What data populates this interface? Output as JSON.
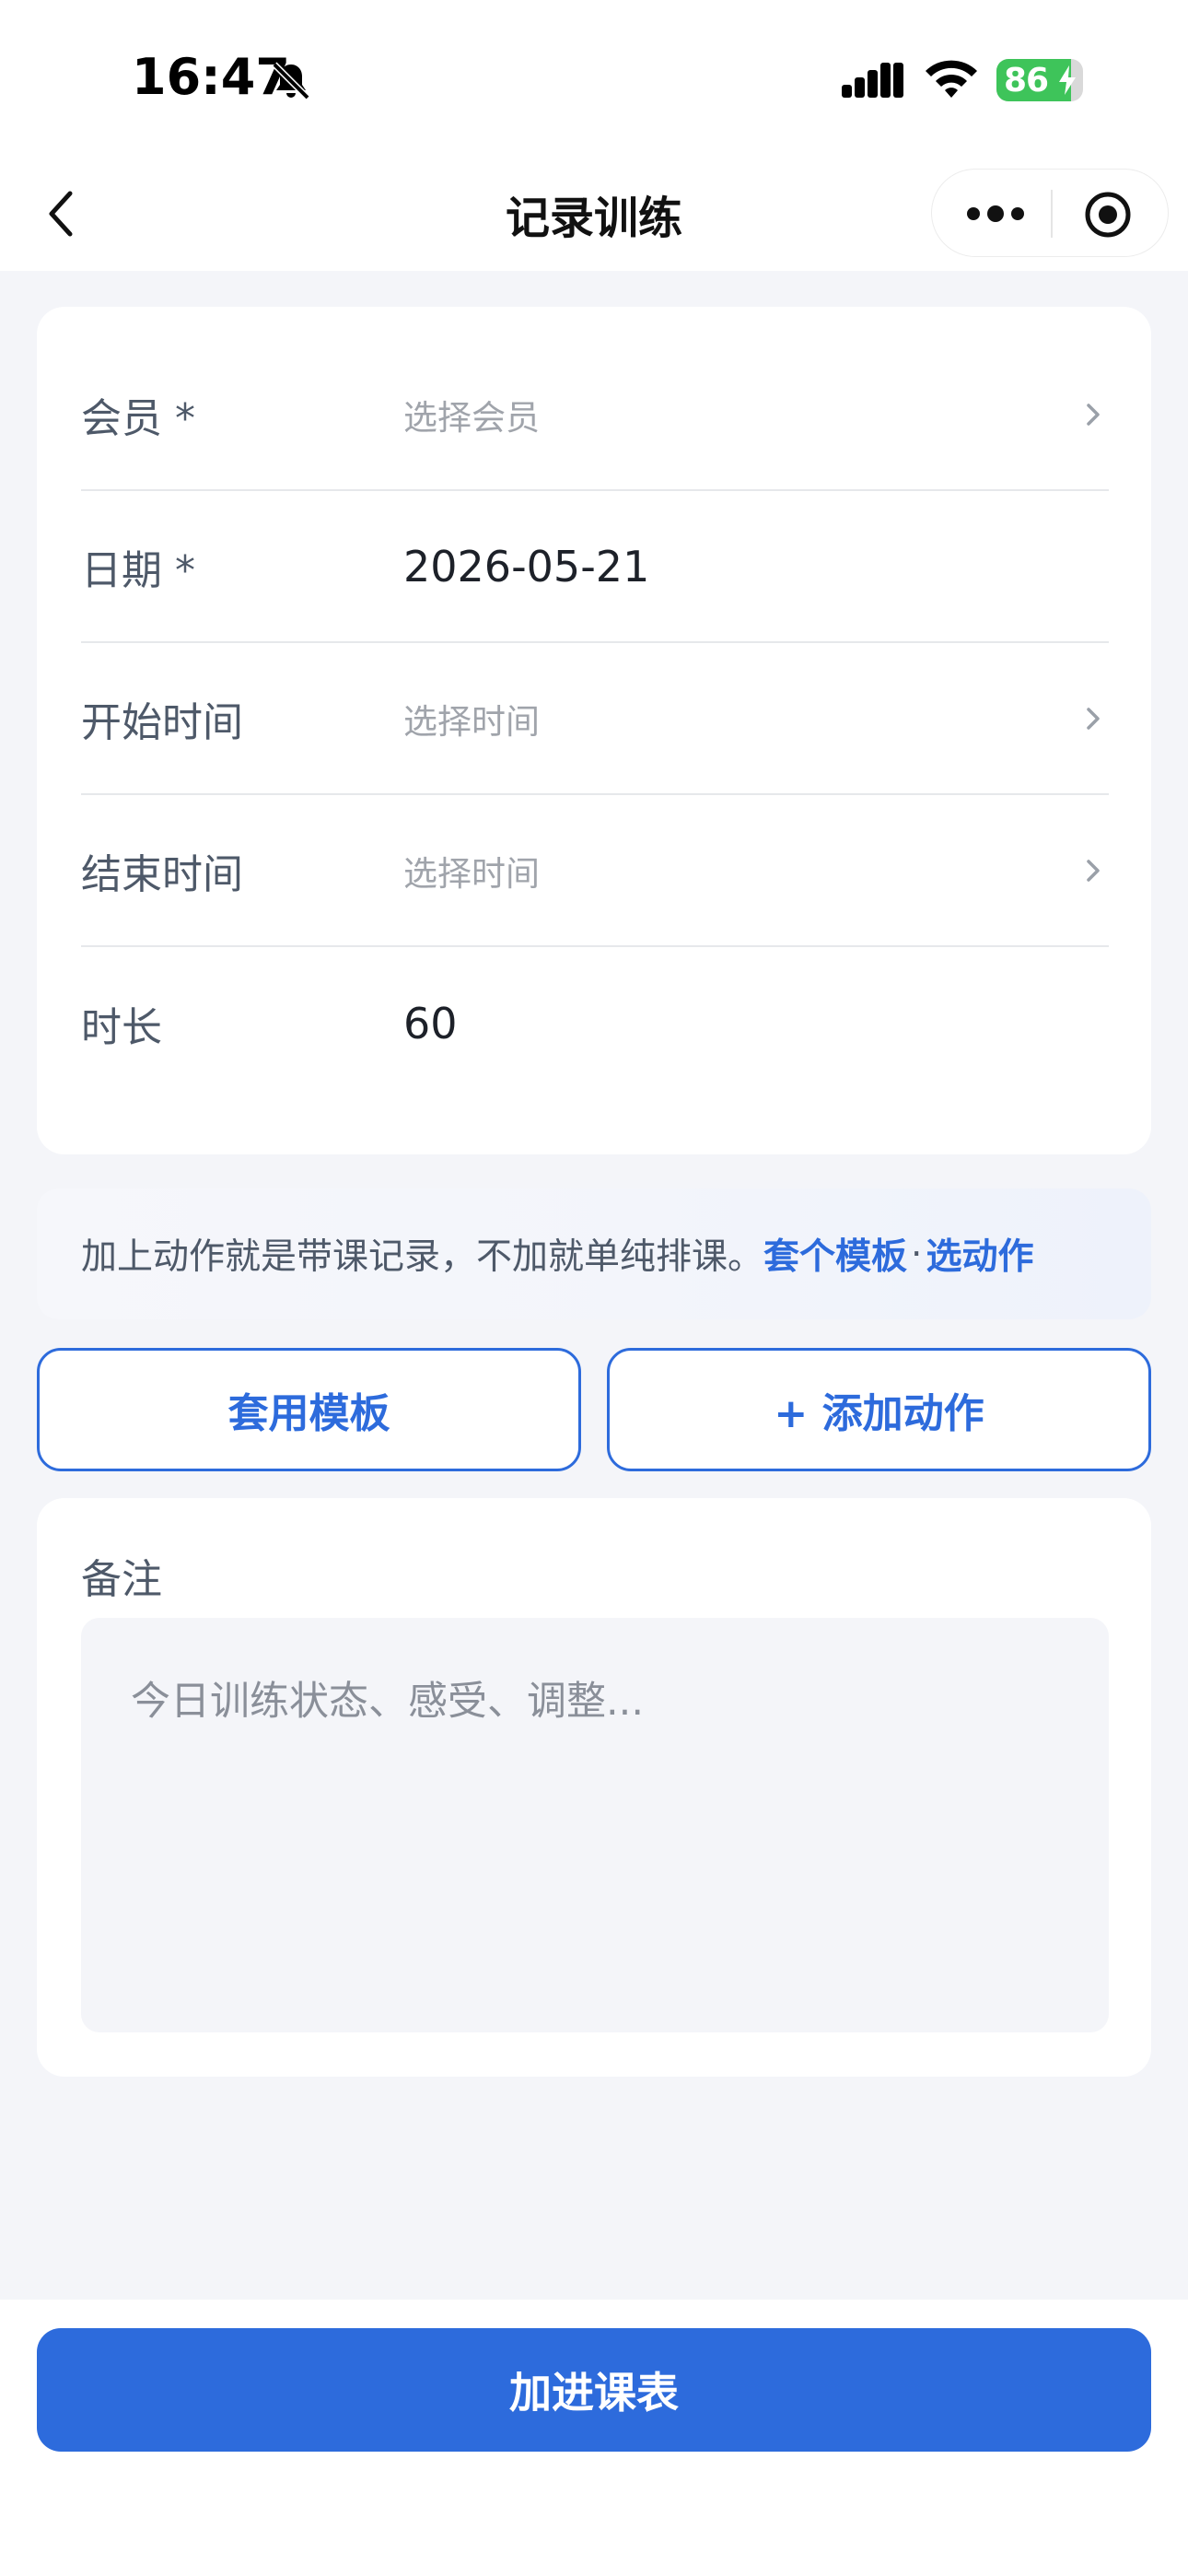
{
  "status_bar": {
    "time": "16:47",
    "battery_level": 86,
    "battery_text": "86",
    "icons": [
      "bell-muted-icon",
      "cellular-signal-icon",
      "wifi-icon",
      "battery-charging-icon"
    ]
  },
  "nav": {
    "title": "记录训练",
    "back_icon": "chevron-left-icon",
    "capsule_icons": [
      "more-dots-icon",
      "target-close-icon"
    ]
  },
  "form": {
    "member": {
      "label": "会员 *",
      "placeholder": "选择会员"
    },
    "date": {
      "label": "日期 *",
      "value": "2026-05-21"
    },
    "start_time": {
      "label": "开始时间",
      "placeholder": "选择时间"
    },
    "end_time": {
      "label": "结束时间",
      "placeholder": "选择时间"
    },
    "duration": {
      "label": "时长",
      "value": "60"
    }
  },
  "hint": {
    "text": "加上动作就是带课记录，不加就单纯排课。",
    "link_template": "套个模板",
    "separator": "·",
    "link_action": "选动作"
  },
  "buttons": {
    "apply_template": "套用模板",
    "add_action": "+ 添加动作",
    "submit": "加进课表"
  },
  "notes": {
    "label": "备注",
    "placeholder": "今日训练状态、感受、调整..."
  },
  "colors": {
    "accent": "#2d6bdc",
    "background": "#f4f5f9",
    "card": "#ffffff",
    "battery": "#3ec45a"
  }
}
